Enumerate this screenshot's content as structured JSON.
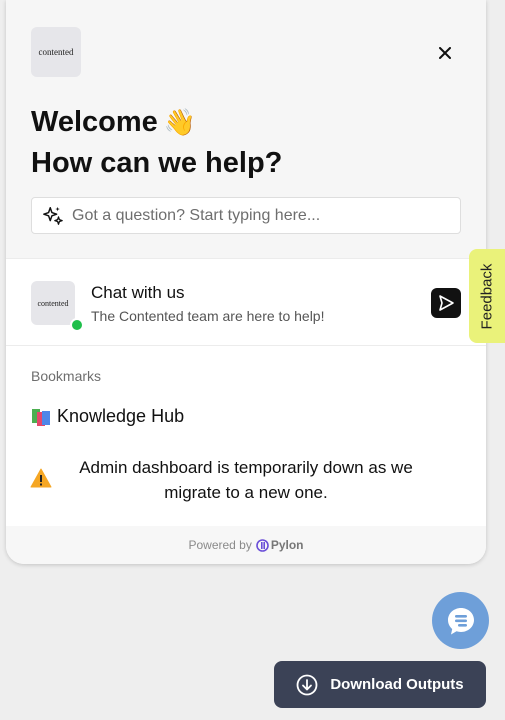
{
  "widget": {
    "logo_text": "contented",
    "welcome_line1": "Welcome",
    "wave_emoji": "👋",
    "welcome_line2": "How can we help?",
    "search_placeholder": "Got a question? Start typing here...",
    "chat": {
      "title": "Chat with us",
      "subtitle": "The Contented team are here to help!",
      "logo_text": "contented"
    },
    "bookmarks": {
      "title": "Bookmarks",
      "items": [
        {
          "label": "Knowledge Hub",
          "icon": "books-icon"
        }
      ]
    },
    "notice": "Admin dashboard is temporarily down as we migrate to a new one.",
    "footer": {
      "powered_by": "Powered by",
      "brand": "Pylon"
    }
  },
  "feedback_tab": {
    "label": "Feedback"
  },
  "download_button": {
    "label": "Download Outputs"
  },
  "colors": {
    "feedback_bg": "#eaf27a",
    "chat_bubble_bg": "#6e9fd9",
    "download_bg": "#3b4256",
    "online_dot": "#1fbf4b",
    "pylon_purple": "#6b4fd8"
  }
}
